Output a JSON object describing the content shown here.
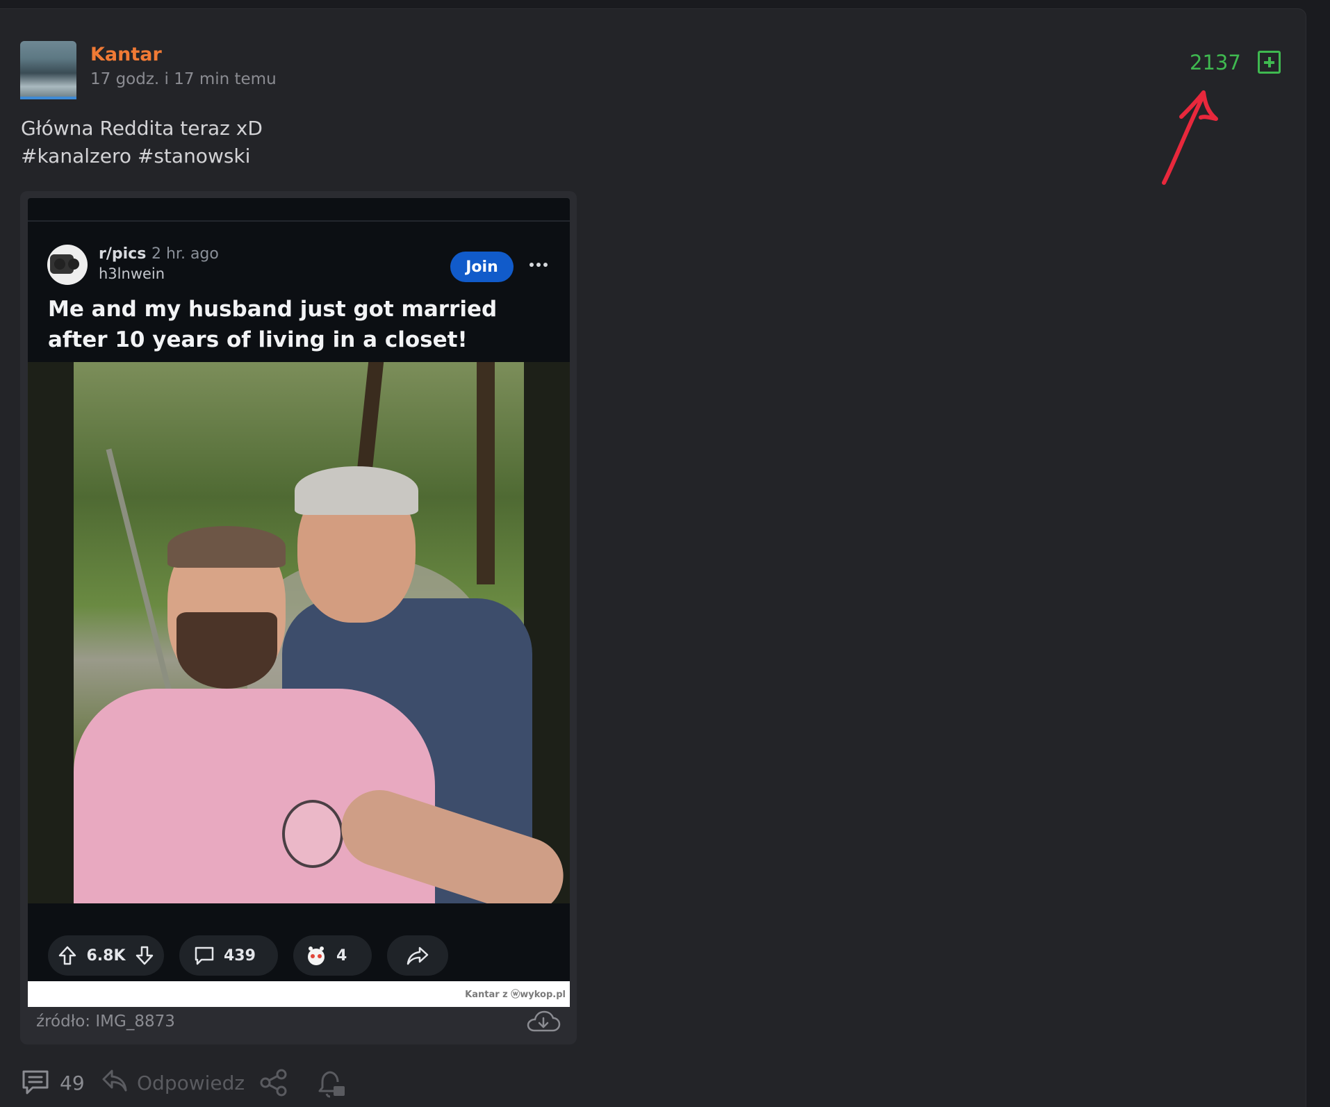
{
  "post": {
    "author": "Kantar",
    "time": "17 godz. i 17 min temu",
    "votes": "2137",
    "body_lines": [
      "Główna Reddita teraz xD",
      "#kanalzero #stanowski"
    ]
  },
  "embed": {
    "reddit": {
      "subreddit": "r/pics",
      "time": "2 hr. ago",
      "user": "h3lnwein",
      "join_label": "Join",
      "title": "Me and my husband just got married after 10 years of living in a closet!",
      "upvotes": "6.8K",
      "comments": "439",
      "awards": "4"
    },
    "watermark": "Kantar z ⓦwykop.pl",
    "source": "źródło: IMG_8873"
  },
  "footer": {
    "comment_count": "49",
    "reply_label": "Odpowiedz"
  },
  "colors": {
    "author": "#f07a35",
    "vote_green": "#3fb950",
    "annotation_arrow": "#e8283c",
    "join_blue": "#115bca"
  }
}
